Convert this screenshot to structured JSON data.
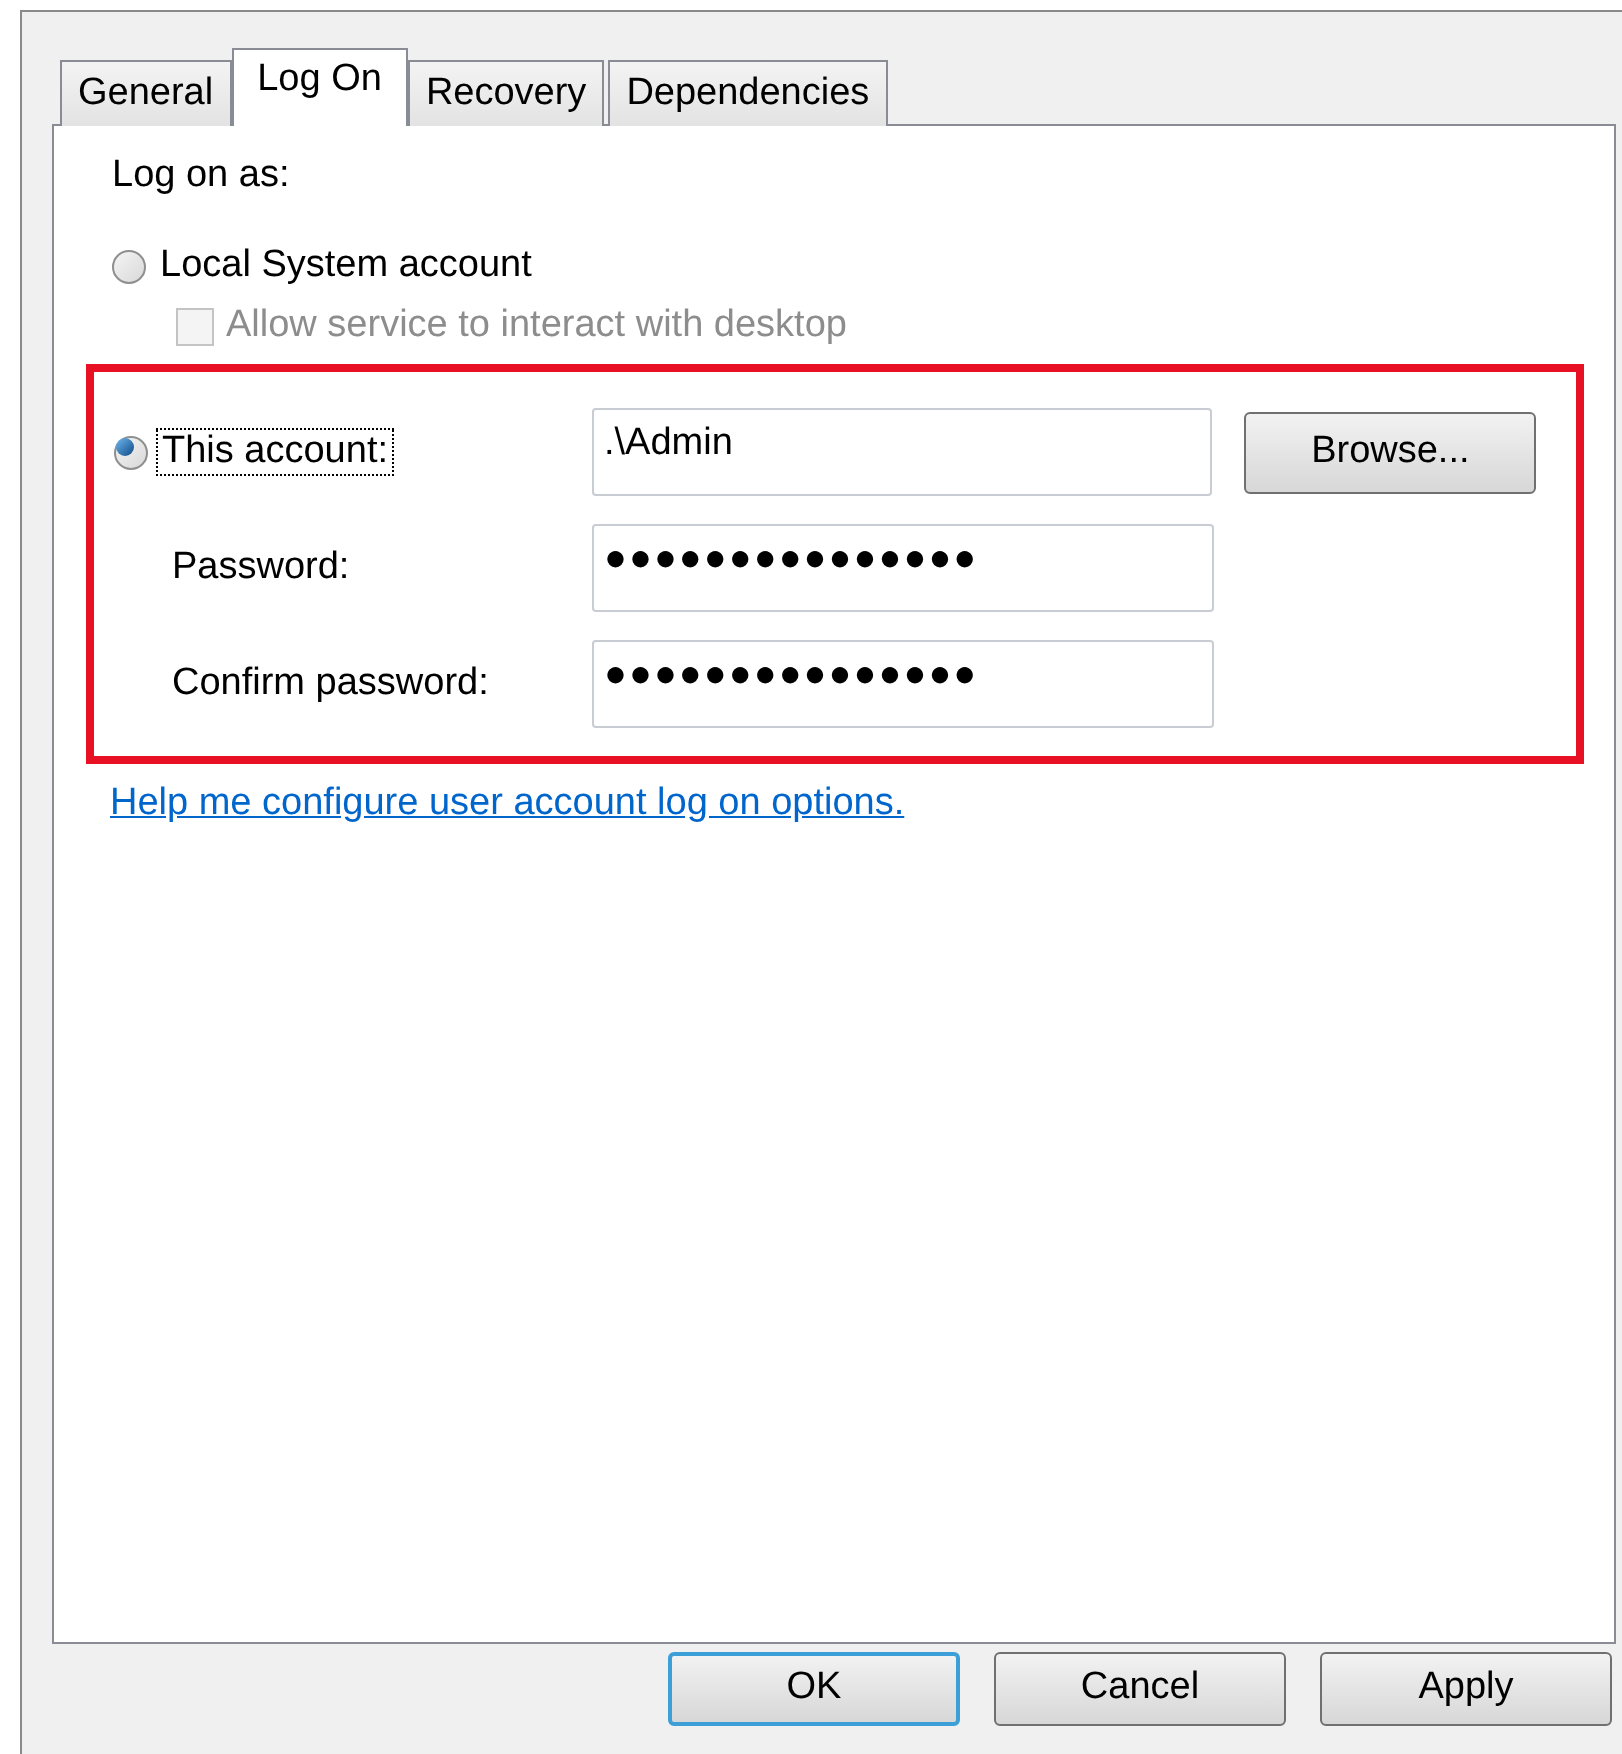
{
  "tabs": [
    {
      "label": "General",
      "selected": false
    },
    {
      "label": "Log On",
      "selected": true
    },
    {
      "label": "Recovery",
      "selected": false
    },
    {
      "label": "Dependencies",
      "selected": false
    }
  ],
  "logon_label": "Log on as:",
  "local_system": {
    "label": "Local System account",
    "selected": false
  },
  "interact_desktop": {
    "label": "Allow service to interact with desktop",
    "checked": false,
    "disabled": true
  },
  "this_account": {
    "label": "This account:",
    "selected": true,
    "value": ".\\Admin"
  },
  "browse_button": "Browse...",
  "password": {
    "label": "Password:",
    "value": "●●●●●●●●●●●●●●●"
  },
  "confirm_password": {
    "label": "Confirm password:",
    "value": "●●●●●●●●●●●●●●●"
  },
  "help_link": "Help me configure user account log on options.",
  "buttons": [
    {
      "label": "OK",
      "default": true
    },
    {
      "label": "Cancel",
      "default": false
    },
    {
      "label": "Apply",
      "default": false
    }
  ]
}
